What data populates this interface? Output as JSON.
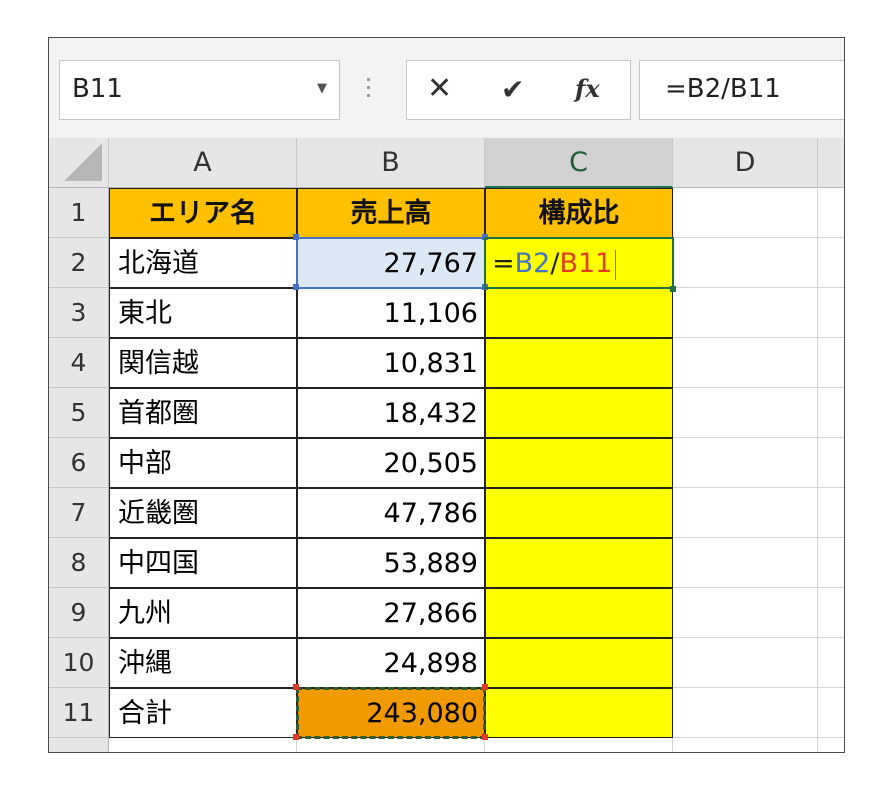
{
  "formula_bar": {
    "name_box": "B11",
    "cancel_icon": "close-icon",
    "enter_icon": "check-icon",
    "fx_label": "fx",
    "formula": "=B2/B11"
  },
  "columns": [
    "A",
    "B",
    "C",
    "D"
  ],
  "rows": [
    "1",
    "2",
    "3",
    "4",
    "5",
    "6",
    "7",
    "8",
    "9",
    "10",
    "11"
  ],
  "table": {
    "headers": [
      "エリア名",
      "売上高",
      "構成比"
    ],
    "data": [
      {
        "area": "北海道",
        "sales": "27,767"
      },
      {
        "area": "東北",
        "sales": "11,106"
      },
      {
        "area": "関信越",
        "sales": "10,831"
      },
      {
        "area": "首都圏",
        "sales": "18,432"
      },
      {
        "area": "中部",
        "sales": "20,505"
      },
      {
        "area": "近畿圏",
        "sales": "47,786"
      },
      {
        "area": "中四国",
        "sales": "53,889"
      },
      {
        "area": "九州",
        "sales": "27,866"
      },
      {
        "area": "沖縄",
        "sales": "24,898"
      },
      {
        "area": "合計",
        "sales": "243,080"
      }
    ]
  },
  "editing_cell": {
    "eq": "=",
    "ref1": "B2",
    "slash": "/",
    "ref2": "B11"
  },
  "colors": {
    "header_fill": "#ffc000",
    "ratio_fill": "#ffff00",
    "ref1_color": "#4472c4",
    "ref2_color": "#e03b24",
    "total_fill": "#f09a00",
    "active_border": "#1e7145"
  }
}
